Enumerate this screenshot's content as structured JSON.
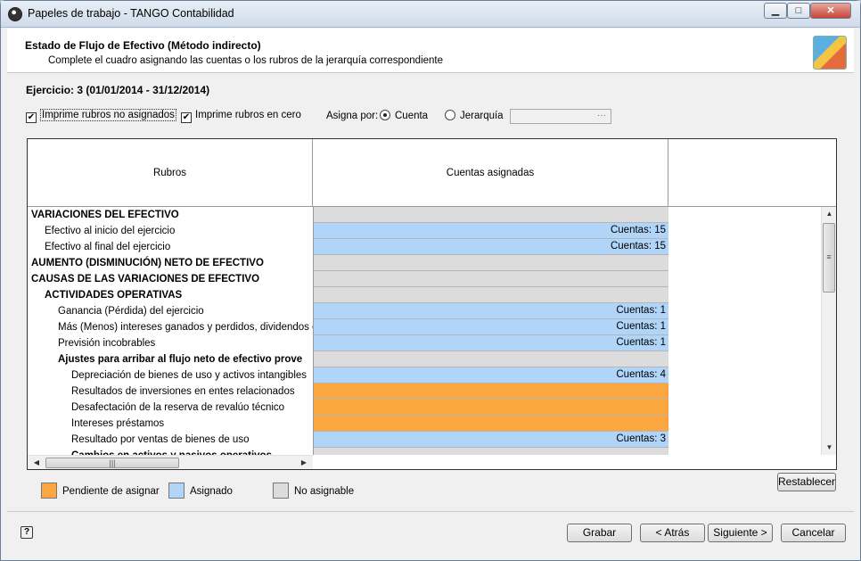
{
  "window": {
    "title": "Papeles de trabajo - TANGO Contabilidad",
    "min_glyph": "▁",
    "max_glyph": "□",
    "close_glyph": "✕"
  },
  "header": {
    "title": "Estado de Flujo de Efectivo (Método indirecto)",
    "subtitle": "Complete el cuadro asignando las cuentas o los rubros de la jerarquía correspondiente"
  },
  "ejercicio": "Ejercicio: 3 (01/01/2014 - 31/12/2014)",
  "options": {
    "imprime_no_asignados": {
      "label": "Imprime rubros no asignados",
      "checked": true,
      "mark": "✔"
    },
    "imprime_en_cero": {
      "label": "Imprime rubros en cero",
      "checked": true,
      "mark": "✔"
    },
    "asigna_por_label": "Asigna por:",
    "radio_cuenta": {
      "label": "Cuenta",
      "selected": true
    },
    "radio_jerarquia": {
      "label": "Jerarquía",
      "selected": false
    },
    "jerarquia_field": {
      "value": "",
      "ellipsis": "···"
    }
  },
  "grid": {
    "columns": [
      "Rubros",
      "Cuentas asignadas"
    ],
    "rows": [
      {
        "label": "VARIACIONES DEL EFECTIVO",
        "bold": true,
        "indent": 0,
        "status": "gray",
        "value": ""
      },
      {
        "label": "Efectivo al inicio del ejercicio",
        "bold": false,
        "indent": 1,
        "status": "blue",
        "value": "Cuentas: 15"
      },
      {
        "label": "Efectivo al final del ejercicio",
        "bold": false,
        "indent": 1,
        "status": "blue",
        "value": "Cuentas: 15"
      },
      {
        "label": "AUMENTO (DISMINUCIÓN) NETO DE EFECTIVO",
        "bold": true,
        "indent": 0,
        "status": "gray",
        "value": ""
      },
      {
        "label": "CAUSAS DE LAS VARIACIONES DE EFECTIVO",
        "bold": true,
        "indent": 0,
        "status": "gray",
        "value": ""
      },
      {
        "label": "ACTIVIDADES OPERATIVAS",
        "bold": true,
        "indent": 1,
        "status": "gray",
        "value": ""
      },
      {
        "label": "Ganancia (Pérdida) del ejercicio",
        "bold": false,
        "indent": 2,
        "status": "blue",
        "value": "Cuentas: 1"
      },
      {
        "label": "Más (Menos) intereses ganados y perdidos, dividendos gana",
        "bold": false,
        "indent": 2,
        "status": "blue",
        "value": "Cuentas: 1"
      },
      {
        "label": "Previsión incobrables",
        "bold": false,
        "indent": 2,
        "status": "blue",
        "value": "Cuentas: 1"
      },
      {
        "label": "Ajustes para arribar al flujo neto de efectivo prove",
        "bold": true,
        "indent": 2,
        "status": "gray",
        "value": ""
      },
      {
        "label": "Depreciación de bienes de uso y activos intangibles",
        "bold": false,
        "indent": 3,
        "status": "blue",
        "value": "Cuentas: 4"
      },
      {
        "label": "Resultados de inversiones en entes relacionados",
        "bold": false,
        "indent": 3,
        "status": "orange",
        "value": ""
      },
      {
        "label": "Desafectación de la reserva de revalúo técnico",
        "bold": false,
        "indent": 3,
        "status": "orange",
        "value": ""
      },
      {
        "label": "Intereses préstamos",
        "bold": false,
        "indent": 3,
        "status": "orange",
        "value": ""
      },
      {
        "label": "Resultado por ventas de bienes de uso",
        "bold": false,
        "indent": 3,
        "status": "blue",
        "value": "Cuentas: 3"
      },
      {
        "label": "Cambios en activos y pasivos operativos",
        "bold": true,
        "indent": 3,
        "status": "gray",
        "value": ""
      }
    ],
    "scroll_up": "▲",
    "scroll_down": "▼",
    "scroll_left": "◀",
    "scroll_right": "▶",
    "v_grip": "≡",
    "h_grip": "|||"
  },
  "legend": {
    "pendiente": "Pendiente de asignar",
    "asignado": "Asignado",
    "no_asignable": "No asignable"
  },
  "colors": {
    "pendiente": "#fba63f",
    "asignado": "#b1d5f9",
    "no_asignable": "#dcdcdc"
  },
  "buttons": {
    "restablecer": "Restablecer",
    "grabar": "Grabar",
    "atras": "< Atrás",
    "siguiente": "Siguiente >",
    "cancelar": "Cancelar",
    "help": "?"
  }
}
